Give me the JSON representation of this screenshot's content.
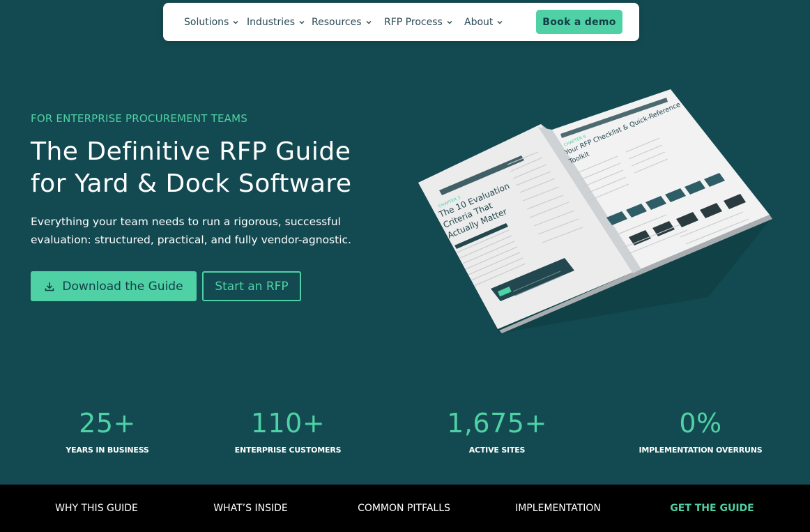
{
  "nav": {
    "items": [
      {
        "label": "Solutions"
      },
      {
        "label": "Industries"
      },
      {
        "label": "Resources"
      },
      {
        "label": "RFP Process"
      },
      {
        "label": "About"
      }
    ],
    "cta_label": "Book a demo"
  },
  "hero": {
    "eyebrow": "FOR ENTERPRISE PROCUREMENT TEAMS",
    "title_line1": "The Definitive RFP Guide",
    "title_line2": "for Yard & Dock Software",
    "subtitle_line1": "Everything your team needs to run a rigorous, successful",
    "subtitle_line2": "evaluation: structured, practical, and fully vendor-agnostic.",
    "primary_button": "Download the Guide",
    "secondary_button": "Start an RFP"
  },
  "book": {
    "left_chapter": "CHAPTER 3",
    "left_heading_1": "The 10 Evaluation",
    "left_heading_2": "Criteria That",
    "left_heading_3": "Actually Matter",
    "right_chapter": "CHAPTER 6",
    "right_heading_1": "Your RFP Checklist & Quick-Reference",
    "right_heading_2": "Toolkit"
  },
  "stats": [
    {
      "value": "25+",
      "label": "YEARS IN BUSINESS"
    },
    {
      "value": "110+",
      "label": "ENTERPRISE CUSTOMERS"
    },
    {
      "value": "1,675+",
      "label": "ACTIVE SITES"
    },
    {
      "value": "0%",
      "label": "IMPLEMENTATION OVERRUNS"
    }
  ],
  "bottom_nav": [
    {
      "label": "WHY THIS GUIDE"
    },
    {
      "label": "WHAT’S INSIDE"
    },
    {
      "label": "COMMON PITFALLS"
    },
    {
      "label": "IMPLEMENTATION"
    },
    {
      "label": "GET THE GUIDE"
    }
  ],
  "colors": {
    "background": "#134a51",
    "accent": "#4fd1a5",
    "nav_text": "#2b4a56",
    "bottom_bar": "#000000"
  },
  "icons": {
    "nav_dropdown": "chevron-down-icon",
    "primary_button": "download-icon"
  }
}
